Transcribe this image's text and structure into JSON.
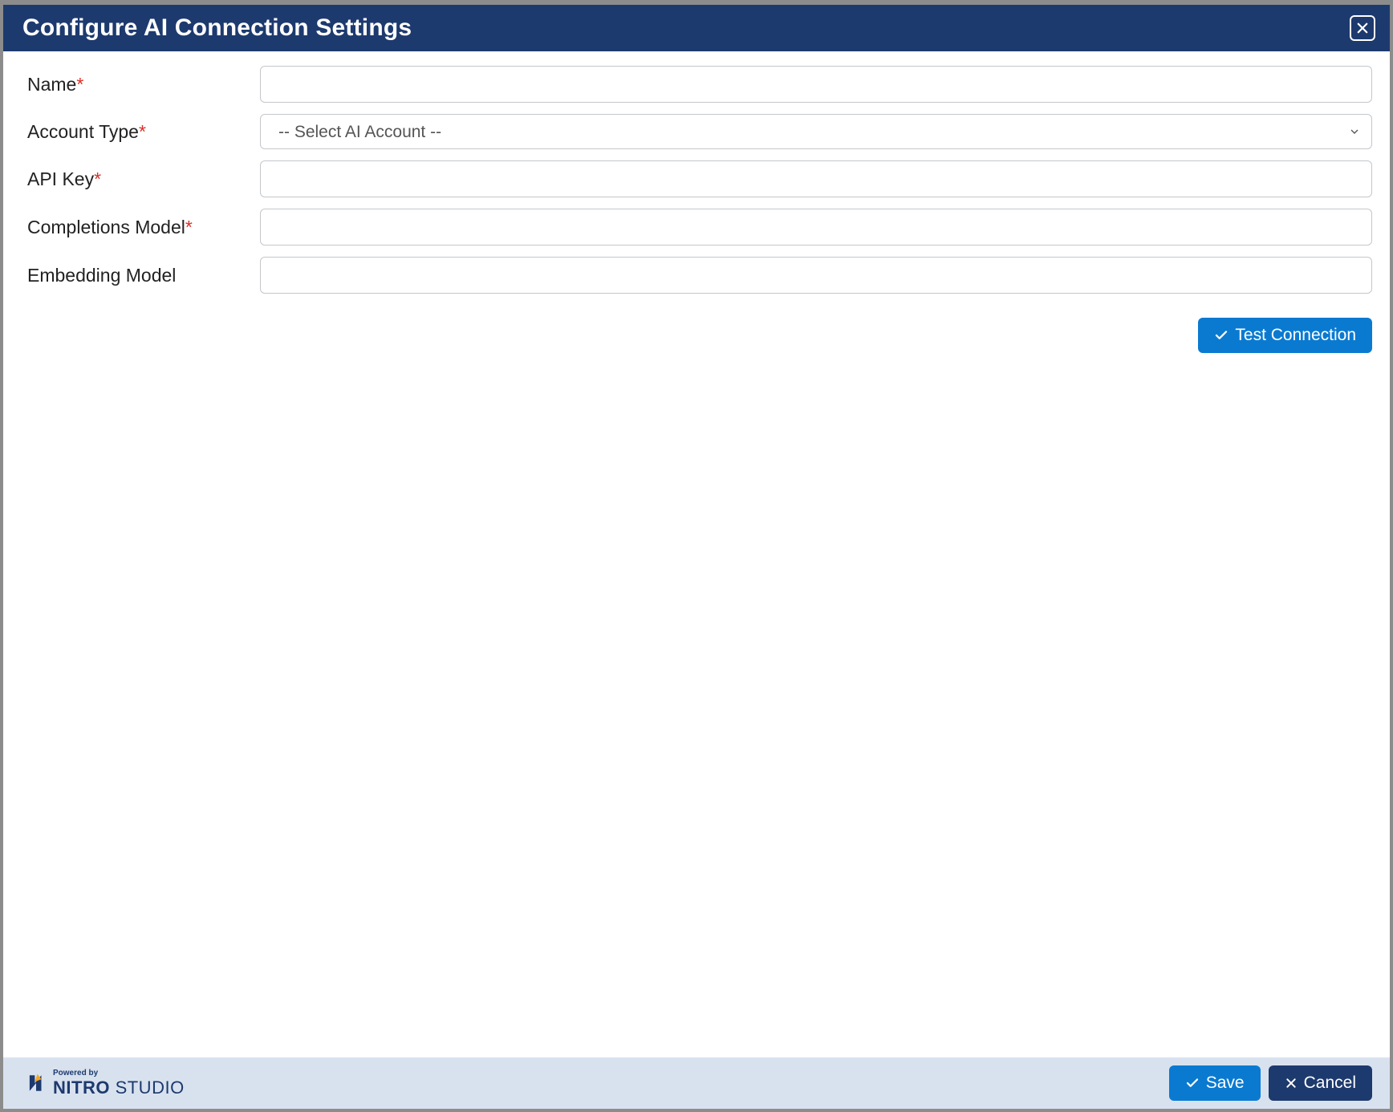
{
  "dialog": {
    "title": "Configure AI Connection Settings"
  },
  "form": {
    "name": {
      "label": "Name",
      "required": true,
      "value": ""
    },
    "account_type": {
      "label": "Account Type",
      "required": true,
      "placeholder": "-- Select AI Account --",
      "value": ""
    },
    "api_key": {
      "label": "API Key",
      "required": true,
      "value": ""
    },
    "completions_model": {
      "label": "Completions Model",
      "required": true,
      "value": ""
    },
    "embedding_model": {
      "label": "Embedding Model",
      "required": false,
      "value": ""
    }
  },
  "buttons": {
    "test_connection": "Test Connection",
    "save": "Save",
    "cancel": "Cancel"
  },
  "brand": {
    "powered_by": "Powered by",
    "name_bold": "NITRO",
    "name_rest": " STUDIO"
  },
  "required_marker": "*"
}
